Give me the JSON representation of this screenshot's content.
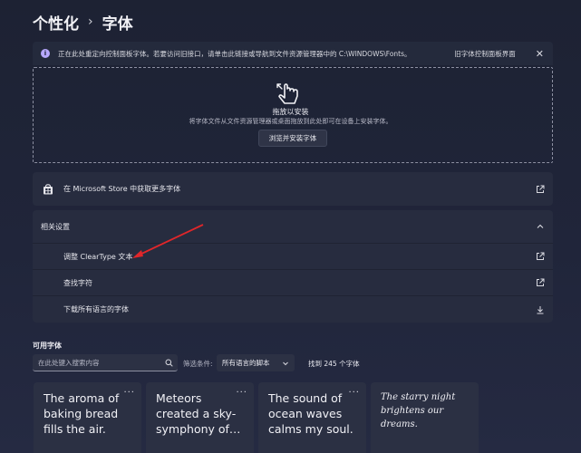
{
  "breadcrumb": {
    "parent": "个性化",
    "separator": "›",
    "current": "字体"
  },
  "info_bar": {
    "icon": "info-icon",
    "message": "正在此处重定向控制面板字体。若要访问旧接口，请单击此链接或导航到文件资源管理器中的 C:\\WINDOWS\\Fonts。",
    "link": "旧字体控制面板界面",
    "close": "✕"
  },
  "drop_zone": {
    "title": "拖放以安装",
    "subtitle": "将字体文件从文件资源管理器或桌面拖放到此处即可在设备上安装字体。",
    "button": "浏览并安装字体"
  },
  "store_row": {
    "label": "在 Microsoft Store 中获取更多字体",
    "icon": "store-icon"
  },
  "related": {
    "title": "相关设置",
    "items": [
      {
        "label": "调整 ClearType 文本",
        "icon": "external-link-icon"
      },
      {
        "label": "查找字符",
        "icon": "external-link-icon"
      },
      {
        "label": "下载所有语言的字体",
        "icon": "download-icon"
      }
    ]
  },
  "available": {
    "title": "可用字体",
    "search_placeholder": "在此处键入搜索内容",
    "filter_label": "筛选条件:",
    "filter_value": "所有语言的脚本",
    "count": "找到 245 个字体"
  },
  "font_cards": [
    {
      "sample": "The aroma of baking bread fills the air.",
      "more": "···"
    },
    {
      "sample": "Meteors created a sky-symphony of…",
      "more": "···"
    },
    {
      "sample": "The sound of ocean waves calms my soul.",
      "more": "···"
    },
    {
      "sample": "The starry night brightens our dreams.",
      "more": "···"
    }
  ],
  "colors": {
    "background": "#1d2233",
    "card": "#272c3f",
    "accent": "#b7a8ff",
    "annotation_arrow": "#e0262a"
  }
}
